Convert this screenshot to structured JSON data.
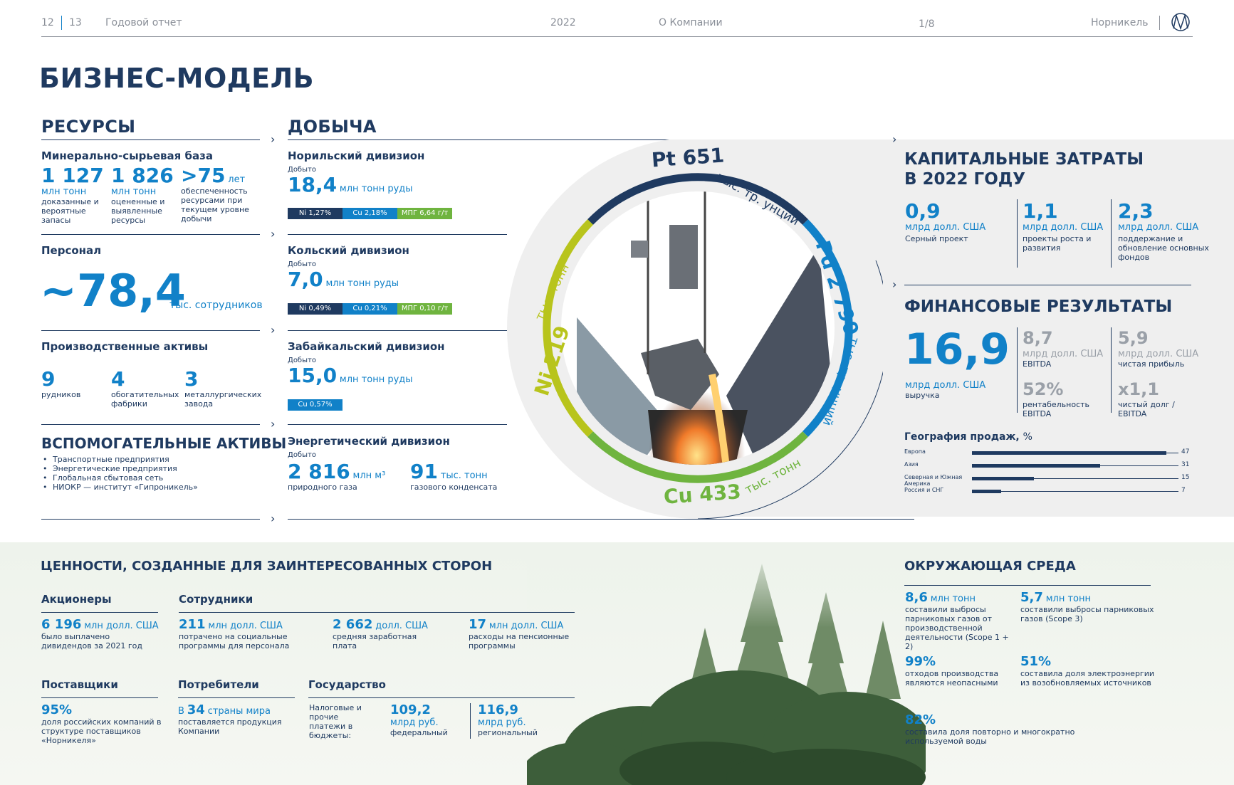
{
  "header": {
    "page_left": "12",
    "page_right": "13",
    "report": "Годовой отчет",
    "year": "2022",
    "section": "О Компании",
    "pager": "1/8",
    "brand": "Норникель"
  },
  "title": "БИЗНЕС-МОДЕЛЬ",
  "resources": {
    "title": "РЕСУРСЫ",
    "mineral": {
      "title": "Минерально-сырьевая база",
      "items": [
        {
          "value": "1 127",
          "unit": "млн тонн",
          "desc": "доказанные и вероятные запасы"
        },
        {
          "value": "1 826",
          "unit": "млн тонн",
          "desc": "оцененные и выявленные ресурсы"
        },
        {
          "value": ">75",
          "unit": "лет",
          "desc": "обеспеченность ресурсами при текущем уровне добычи"
        }
      ]
    },
    "staff": {
      "title": "Персонал",
      "value": "~78,4",
      "unit": "тыс. сотрудников"
    },
    "assets": {
      "title": "Производственные активы",
      "items": [
        {
          "value": "9",
          "desc": "рудников"
        },
        {
          "value": "4",
          "desc": "обогатительных фабрики"
        },
        {
          "value": "3",
          "desc": "металлургических завода"
        }
      ]
    },
    "aux": {
      "title": "ВСПОМОГАТЕЛЬНЫЕ АКТИВЫ",
      "items": [
        "Транспортные предприятия",
        "Энергетические предприятия",
        "Глобальная сбытовая сеть",
        "НИОКР — институт «Гипроникель»"
      ]
    }
  },
  "mining": {
    "title": "ДОБЫЧА",
    "divisions": [
      {
        "title": "Норильский дивизион",
        "label": "Добыто",
        "value": "18,4",
        "unit": "млн тонн руды",
        "tags": [
          "Ni 1,27%",
          "Cu 2,18%",
          "МПГ 6,64 г/т"
        ]
      },
      {
        "title": "Кольский дивизион",
        "label": "Добыто",
        "value": "7,0",
        "unit": "млн тонн руды",
        "tags": [
          "Ni 0,49%",
          "Cu 0,21%",
          "МПГ 0,10 г/т"
        ]
      },
      {
        "title": "Забайкальский дивизион",
        "label": "Добыто",
        "value": "15,0",
        "unit": "млн тонн руды",
        "tags": [
          "Cu 0,57%"
        ]
      }
    ],
    "energy": {
      "title": "Энергетический дивизион",
      "label": "Добыто",
      "items": [
        {
          "value": "2 816",
          "unit": "млн м³",
          "desc": "природного газа"
        },
        {
          "value": "91",
          "unit": "тыс. тонн",
          "desc": "газового конденсата"
        }
      ]
    }
  },
  "ring": {
    "pt": {
      "metal": "Pt 651",
      "unit": "тыс. тр. унций",
      "color": "#1f3a60"
    },
    "pd": {
      "metal": "Pd 2 790",
      "unit": "тыс. тр. унций",
      "color": "#1181c8"
    },
    "cu": {
      "metal": "Cu 433",
      "unit": "тыс. тонн",
      "color": "#6fb43f"
    },
    "ni": {
      "metal": "Ni 219",
      "unit": "тыс. тонн",
      "color": "#b8c41c"
    }
  },
  "capex": {
    "title1": "КАПИТАЛЬНЫЕ ЗАТРАТЫ",
    "title2": "В 2022 ГОДУ",
    "items": [
      {
        "value": "0,9",
        "unit": "млрд долл. США",
        "desc": "Серный проект"
      },
      {
        "value": "1,1",
        "unit": "млрд долл. США",
        "desc": "проекты роста и развития"
      },
      {
        "value": "2,3",
        "unit": "млрд долл. США",
        "desc": "поддержание и обновление основных фондов"
      }
    ]
  },
  "finance": {
    "title": "ФИНАНСОВЫЕ РЕЗУЛЬТАТЫ",
    "revenue": {
      "value": "16,9",
      "unit": "млрд долл. США",
      "desc": "выручка"
    },
    "items": [
      {
        "value": "8,7",
        "unit": "млрд долл. США",
        "desc": "EBITDA"
      },
      {
        "value": "5,9",
        "unit": "млрд долл. США",
        "desc": "чистая прибыль"
      },
      {
        "value": "52%",
        "unit": "",
        "desc": "рентабельность EBITDA"
      },
      {
        "value": "x1,1",
        "unit": "",
        "desc": "чистый долг / EBITDA"
      }
    ]
  },
  "chart_data": {
    "type": "bar",
    "title": "География продаж,",
    "title_unit": "%",
    "categories": [
      "Европа",
      "Азия",
      "Северная и Южная Америка",
      "Россия и СНГ"
    ],
    "values": [
      47,
      31,
      15,
      7
    ],
    "xlim": [
      0,
      50
    ]
  },
  "values": {
    "title": "ЦЕННОСТИ, СОЗДАННЫЕ ДЛЯ ЗАИНТЕРЕСОВАННЫХ СТОРОН",
    "shareholders": {
      "title": "Акционеры",
      "value": "6 196",
      "unit": "млн долл. США",
      "desc": "было выплачено дивидендов за 2021 год"
    },
    "employees": {
      "title": "Сотрудники",
      "items": [
        {
          "value": "211",
          "unit": "млн долл. США",
          "desc": "потрачено на социальные программы для персонала"
        },
        {
          "value": "2 662",
          "unit": "долл. США",
          "desc": "средняя заработная плата"
        },
        {
          "value": "17",
          "unit": "млн долл. США",
          "desc": "расходы на пенсионные программы"
        }
      ]
    },
    "suppliers": {
      "title": "Поставщики",
      "value": "95%",
      "desc": "доля российских компаний в структуре поставщиков «Норникеля»"
    },
    "consumers": {
      "title": "Потребители",
      "prefix": "В",
      "value": "34",
      "unit": "страны мира",
      "desc": "поставляется продукция Компании"
    },
    "state": {
      "title": "Государство",
      "desc": "Налоговые и прочие платежи в бюджеты:",
      "items": [
        {
          "value": "109,2",
          "unit": "млрд руб.",
          "desc": "федеральный"
        },
        {
          "value": "116,9",
          "unit": "млрд руб.",
          "desc": "региональный"
        }
      ]
    }
  },
  "environment": {
    "title": "ОКРУЖАЮЩАЯ СРЕДА",
    "items": [
      {
        "value": "8,6",
        "unit": "млн тонн",
        "desc": "составили выбросы парниковых газов от производственной деятельности (Scope 1 + 2)"
      },
      {
        "value": "5,7",
        "unit": "млн тонн",
        "desc": "составили выбросы парниковых газов (Scope 3)"
      },
      {
        "value": "99%",
        "unit": "",
        "desc": "отходов производства являются неопасными"
      },
      {
        "value": "51%",
        "unit": "",
        "desc": "составила доля электроэнергии из возобновляемых источников"
      },
      {
        "value": "82%",
        "unit": "",
        "desc": "составила доля повторно и многократно используемой воды"
      }
    ]
  }
}
